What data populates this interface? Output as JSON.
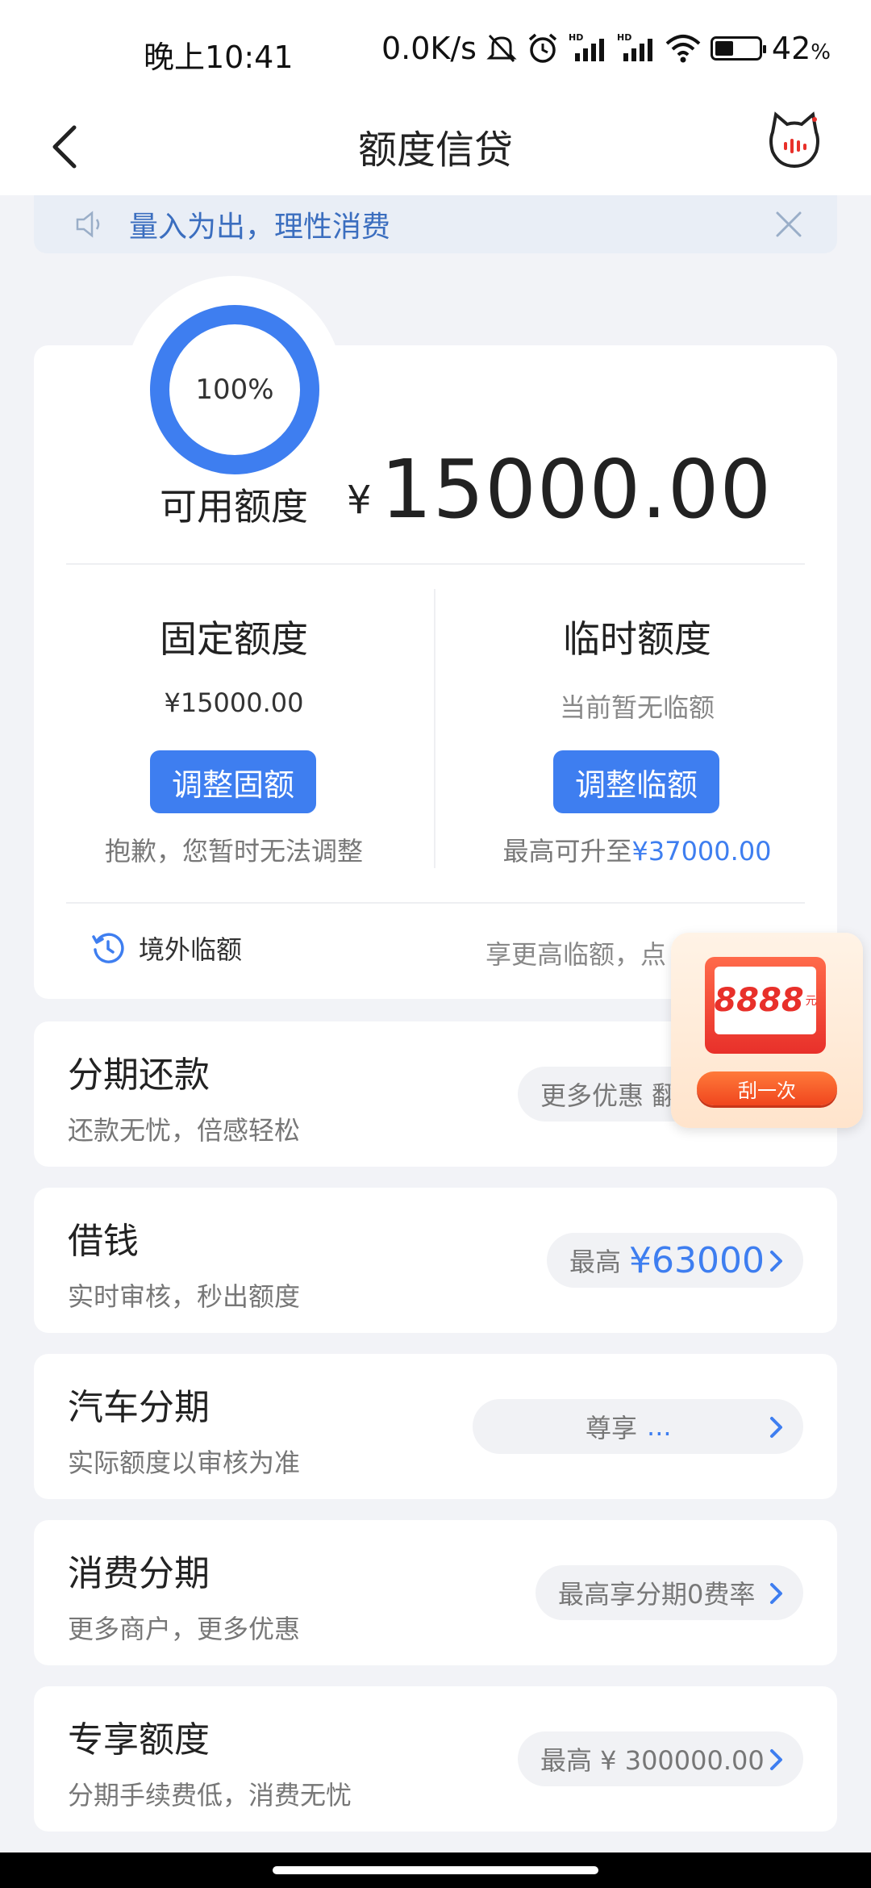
{
  "status_bar": {
    "time": "晚上10:41",
    "network_speed": "0.0K/s",
    "battery": "42",
    "battery_unit": "%",
    "battery_level": 0.42,
    "icons": [
      "mute-bell-icon",
      "alarm-icon",
      "signal-hd-icon",
      "signal-hd-icon",
      "wifi-icon",
      "battery-icon"
    ]
  },
  "nav": {
    "title": "额度信贷",
    "back_icon": "chevron-left-icon",
    "assistant_icon": "cat-assistant-icon"
  },
  "notice": {
    "text": "量入为出，理性消费",
    "icon": "speaker-icon",
    "close_icon": "close-icon"
  },
  "credit": {
    "ring_percent": "100%",
    "ring_fraction": 1.0,
    "available_label": "可用额度",
    "currency": "¥",
    "available_amount": "15000.00",
    "fixed": {
      "title": "固定额度",
      "value": "¥15000.00",
      "button": "调整固额",
      "note": "抱歉，您暂时无法调整"
    },
    "temporary": {
      "title": "临时额度",
      "value": "当前暂无临额",
      "button": "调整临额",
      "note_prefix": "最高可升至",
      "note_amount": "¥37000.00"
    },
    "overseas": {
      "label": "境外临额",
      "tip": "享更高临额，点"
    }
  },
  "products": [
    {
      "title": "分期还款",
      "subtitle": "还款无忧，倍感轻松",
      "pill_text": "更多优惠 翻"
    },
    {
      "title": "借钱",
      "subtitle": "实时审核，秒出额度",
      "pill_prefix": "最高",
      "pill_amount": "¥63000"
    },
    {
      "title": "汽车分期",
      "subtitle": "实际额度以审核为准",
      "pill_prefix": "尊享",
      "pill_amount": "..."
    },
    {
      "title": "消费分期",
      "subtitle": "更多商户，更多优惠",
      "pill_text": "最高享分期0费率"
    },
    {
      "title": "专享额度",
      "subtitle": "分期手续费低，消费无忧",
      "pill_text": "最高 ¥ 300000.00"
    }
  ],
  "float_ad": {
    "amount": "8888",
    "unit": "元",
    "button": "刮一次"
  },
  "colors": {
    "accent": "#3e7ef0",
    "notice_text": "#3b6ebf",
    "background": "#f2f3f7",
    "ad_red": "#e8302a"
  }
}
